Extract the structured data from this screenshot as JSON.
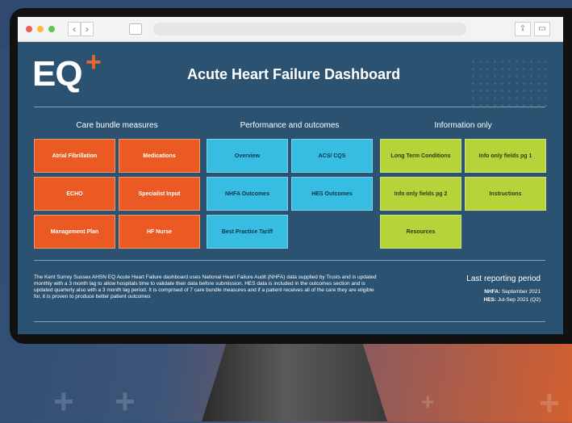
{
  "browser": {
    "nav_back": "‹",
    "nav_forward": "›",
    "share_glyph": "⇪",
    "tabs_glyph": "▭"
  },
  "dashboard": {
    "logo_text": "EQ",
    "logo_plus": "+",
    "title": "Acute Heart Failure Dashboard",
    "groups": [
      {
        "heading": "Care bundle measures",
        "tiles": [
          "Atrial Fibrillation",
          "Medications",
          "ECHO",
          "Specialist Input",
          "Management Plan",
          "HF Nurse"
        ]
      },
      {
        "heading": "Performance and outcomes",
        "tiles": [
          "Overview",
          "ACS/ CQS",
          "NHFA Outcomes",
          "HES Outcomes",
          "Best Practice Tariff"
        ]
      },
      {
        "heading": "Information only",
        "tiles": [
          "Long Term Conditions",
          "Info only fields pg 1",
          "Info only fields pg 2",
          "Instructions",
          "Resources"
        ]
      }
    ],
    "description": "The Kent Surrey Sussex AHSN EQ Acute Heart Failure dashboard uses National Heart Failure Audit (NHFA) data supplied by Trusts and is updated monthly with a 3 month lag to allow hospitals time to validate their data before submission. HES data is included in the outcomes section and is updated quarterly also with a 3 month lag period. It is comprised of 7 care bundle measures and if a patient receives all of the care they are eligible for, it is proven to produce better patient outcomes",
    "last_reporting": {
      "heading": "Last reporting period",
      "nhfa_label": "NHFA:",
      "nhfa_value": "September 2021",
      "hes_label": "HES:",
      "hes_value": "Jul-Sep 2021 (Q2)"
    }
  },
  "colors": {
    "orange": "#ec5a24",
    "cyan": "#36bde1",
    "green": "#b6d33a",
    "screen": "#2b5270"
  }
}
